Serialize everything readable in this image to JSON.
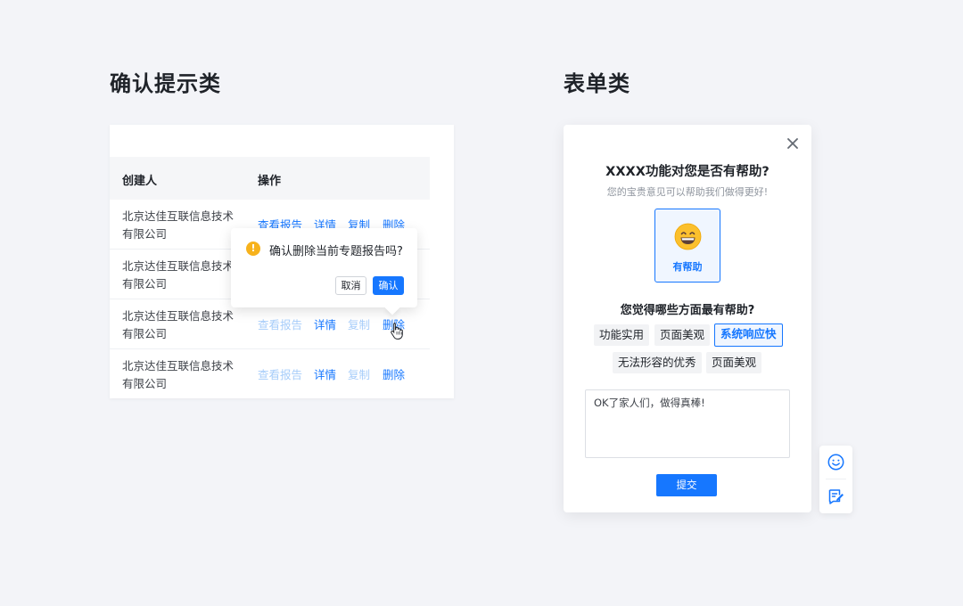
{
  "sections": {
    "left_title": "确认提示类",
    "right_title": "表单类"
  },
  "table": {
    "headers": {
      "creator": "创建人",
      "actions": "操作"
    },
    "action_labels": {
      "report": "查看报告",
      "detail": "详情",
      "copy": "复制",
      "delete": "删除"
    },
    "rows": [
      {
        "creator": "北京达佳互联信息技术有限公司"
      },
      {
        "creator": "北京达佳互联信息技术有限公司"
      },
      {
        "creator": "北京达佳互联信息技术有限公司"
      },
      {
        "creator": "北京达佳互联信息技术有限公司"
      }
    ]
  },
  "popconfirm": {
    "message": "确认删除当前专题报告吗?",
    "cancel_label": "取消",
    "confirm_label": "确认",
    "icon": "warning-icon"
  },
  "feedback": {
    "title": "XXXX功能对您是否有帮助?",
    "subtitle": "您的宝贵意见可以帮助我们做得更好!",
    "helpful_label": "有帮助",
    "question": "您觉得哪些方面最有帮助?",
    "tags": [
      {
        "label": "功能实用",
        "selected": false
      },
      {
        "label": "页面美观",
        "selected": false
      },
      {
        "label": "系统响应快",
        "selected": true
      },
      {
        "label": "无法形容的优秀",
        "selected": false
      },
      {
        "label": "页面美观",
        "selected": false
      }
    ],
    "comment_value": "OK了家人们，做得真棒!",
    "submit_label": "提交"
  },
  "colors": {
    "primary": "#1677ff",
    "primary_disabled": "#a7cdfa",
    "warning": "#f7b21c",
    "background": "#f3f4f8"
  }
}
